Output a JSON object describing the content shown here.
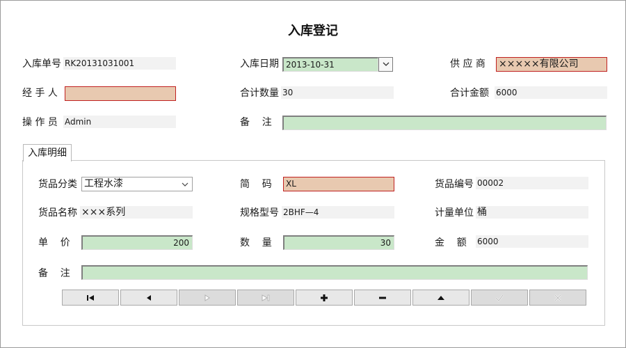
{
  "form": {
    "title": "入库登记"
  },
  "header": {
    "order_no": {
      "label": "入库单号",
      "value": "RK20131031001"
    },
    "date": {
      "label": "入库日期",
      "value": "2013-10-31"
    },
    "supplier": {
      "label": "供 应 商",
      "value": "×××××有限公司"
    },
    "handler": {
      "label": "经 手 人",
      "value": ""
    },
    "total_qty": {
      "label": "合计数量",
      "value": "30"
    },
    "total_amount": {
      "label": "合计金额",
      "value": "6000"
    },
    "operator": {
      "label": "操 作 员",
      "value": "Admin"
    },
    "remark": {
      "label": "备    注",
      "value": ""
    }
  },
  "details": {
    "tab_label": "入库明细",
    "category": {
      "label": "货品分类",
      "value": "工程水漆"
    },
    "short_code": {
      "label": "简    码",
      "value": "XL"
    },
    "item_code": {
      "label": "货品编号",
      "value": "00002"
    },
    "item_name": {
      "label": "货品名称",
      "value": "×××系列"
    },
    "spec": {
      "label": "规格型号",
      "value": "2BHF—4"
    },
    "unit": {
      "label": "计量单位",
      "value": "桶"
    },
    "price": {
      "label": "单    价",
      "value": "200"
    },
    "quantity": {
      "label": "数    量",
      "value": "30"
    },
    "amount": {
      "label": "金    额",
      "value": "6000"
    },
    "remark": {
      "label": "备    注",
      "value": ""
    }
  },
  "navigator": {
    "buttons": [
      {
        "name": "first-record",
        "icon": "first-icon",
        "enabled": true
      },
      {
        "name": "prior-record",
        "icon": "prior-icon",
        "enabled": true
      },
      {
        "name": "next-record",
        "icon": "next-icon",
        "enabled": false
      },
      {
        "name": "last-record",
        "icon": "last-icon",
        "enabled": false
      },
      {
        "name": "insert-record",
        "icon": "plus-icon",
        "enabled": true
      },
      {
        "name": "delete-record",
        "icon": "minus-icon",
        "enabled": true
      },
      {
        "name": "edit-record",
        "icon": "up-arrow-icon",
        "enabled": true
      },
      {
        "name": "post-record",
        "icon": "check-icon",
        "enabled": false
      },
      {
        "name": "cancel-record",
        "icon": "cancel-icon",
        "enabled": false
      }
    ]
  },
  "colors": {
    "editable_field": "#c9e7c9",
    "required_field": "#e8c9b0",
    "required_border": "#c02020",
    "readonly_field": "#f2f2f2"
  }
}
